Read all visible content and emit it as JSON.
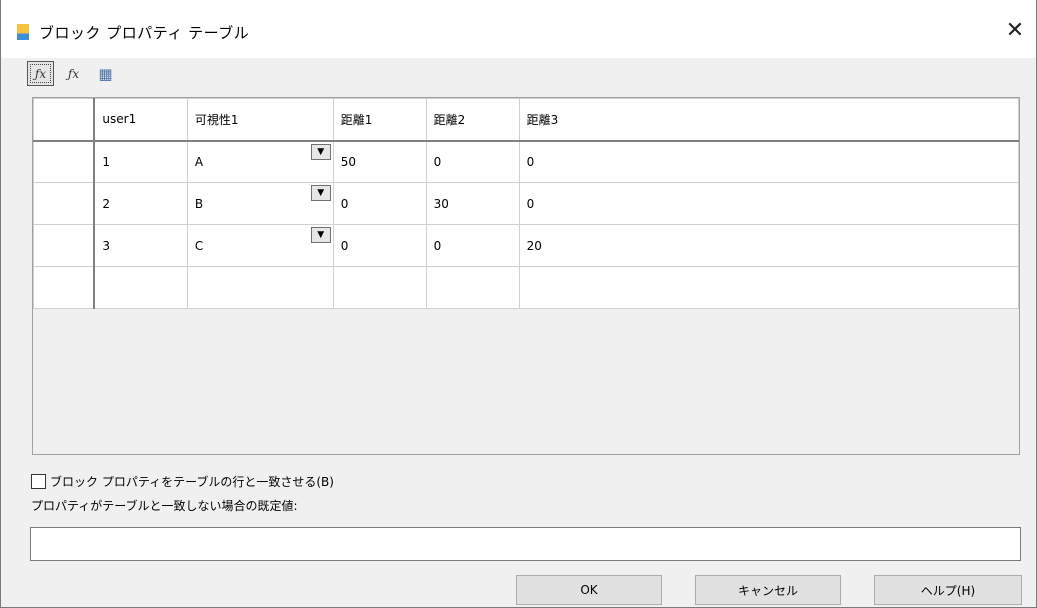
{
  "window": {
    "title": "ブロック プロパティ テーブル",
    "close_label": "✕"
  },
  "toolbar": [
    {
      "name": "add-user-parameter-button",
      "glyph": "ƒx",
      "icon": "fx-plus-icon"
    },
    {
      "name": "add-parameter-button",
      "glyph": "ƒx",
      "icon": "fx-star-icon"
    },
    {
      "name": "audit-table-button",
      "glyph": "▦",
      "icon": "table-check-icon"
    }
  ],
  "table": {
    "columns": [
      "user1",
      "可視性1",
      "距離1",
      "距離2",
      "距離3"
    ],
    "rows": [
      [
        "1",
        "A",
        "50",
        "0",
        "0"
      ],
      [
        "2",
        "B",
        "0",
        "30",
        "0"
      ],
      [
        "3",
        "C",
        "0",
        "0",
        "20"
      ],
      [
        "",
        "",
        "",
        "",
        ""
      ]
    ],
    "dropdown_glyph": "▼"
  },
  "options": {
    "match_checkbox_label": "ブロック プロパティをテーブルの行と一致させる(B)",
    "match_checked": false,
    "default_label": "プロパティがテーブルと一致しない場合の既定値:",
    "default_value": ""
  },
  "buttons": {
    "ok": "OK",
    "cancel": "キャンセル",
    "help": "ヘルプ(H)"
  }
}
